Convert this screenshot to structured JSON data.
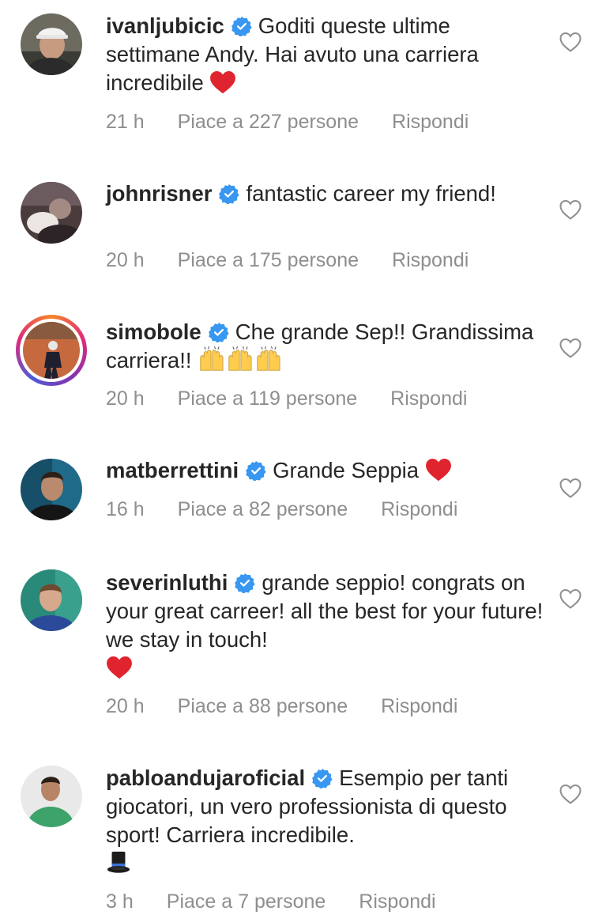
{
  "comments": [
    {
      "username": "ivanljubicic",
      "text": "Goditi queste ultime settimane Andy. Hai avuto una carriera incredibile",
      "emoji": "red-heart",
      "time": "21 h",
      "likes": "Piace a 227 persone",
      "reply": "Rispondi"
    },
    {
      "username": "johnrisner",
      "text": "fantastic career my friend!",
      "time": "20 h",
      "likes": "Piace a 175 persone",
      "reply": "Rispondi"
    },
    {
      "username": "simobole",
      "text": "Che grande Sep!! Grandissima carriera!!",
      "emoji": "raising-hands",
      "time": "20 h",
      "likes": "Piace a 119 persone",
      "reply": "Rispondi"
    },
    {
      "username": "matberrettini",
      "text": "Grande Seppia",
      "emoji": "red-heart",
      "time": "16 h",
      "likes": "Piace a 82 persone",
      "reply": "Rispondi"
    },
    {
      "username": "severinluthi",
      "text": "grande seppio! congrats on your great carreer! all the best for your future! we stay in touch!",
      "emoji": "red-heart",
      "time": "20 h",
      "likes": "Piace a 88 persone",
      "reply": "Rispondi"
    },
    {
      "username": "pabloandujaroficial",
      "text": "Esempio per tanti giocatori, un vero professionista di questo sport! Carriera incredibile.",
      "emoji": "top-hat",
      "time": "3 h",
      "likes": "Piace a 7 persone",
      "reply": "Rispondi"
    }
  ],
  "colors": {
    "text": "#262626",
    "meta": "#8e8e8e",
    "verified": "#3897f0",
    "heart_emoji": "#e0242f"
  }
}
